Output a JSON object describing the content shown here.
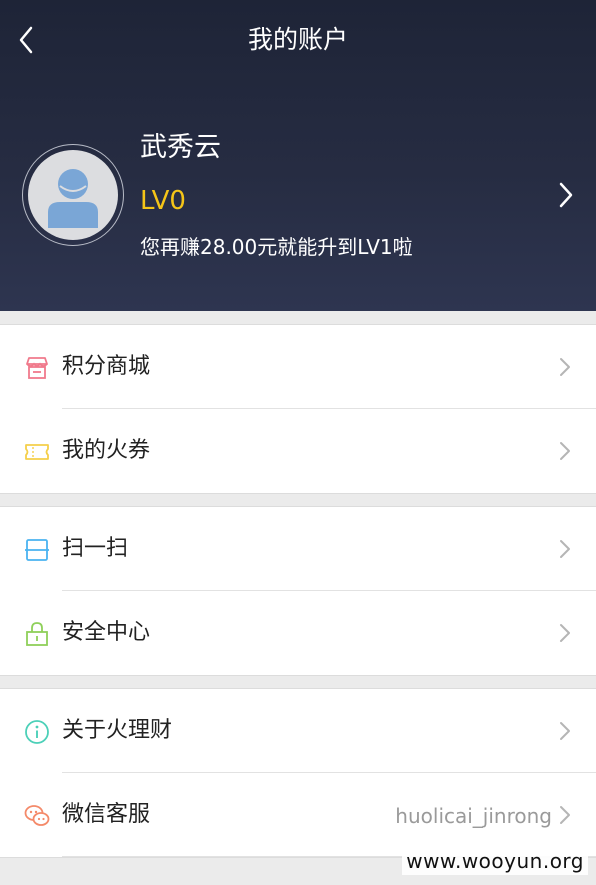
{
  "header": {
    "title": "我的账户",
    "back_icon": "back-chevron-icon"
  },
  "profile": {
    "name": "武秀云",
    "level": "LV0",
    "upgrade_text": "您再赚28.00元就能升到LV1啦",
    "arrow_icon": "chevron-right-icon",
    "avatar_icon": "default-avatar-icon"
  },
  "groups": [
    {
      "items": [
        {
          "label": "积分商城",
          "icon": "store-icon",
          "icon_color": "#f07a8c"
        },
        {
          "label": "我的火券",
          "icon": "ticket-icon",
          "icon_color": "#f5cf4a"
        }
      ]
    },
    {
      "items": [
        {
          "label": "扫一扫",
          "icon": "scan-icon",
          "icon_color": "#4ab3f0"
        },
        {
          "label": "安全中心",
          "icon": "lock-icon",
          "icon_color": "#8fd05a"
        }
      ]
    },
    {
      "items": [
        {
          "label": "关于火理财",
          "icon": "info-icon",
          "icon_color": "#4cd0b8"
        },
        {
          "label": "微信客服",
          "value": "huolicai_jinrong",
          "icon": "wechat-icon",
          "icon_color": "#f48a6a"
        }
      ]
    }
  ],
  "watermark": "www.wooyun.org",
  "colors": {
    "header_bg": "#262c42",
    "level": "#f5c518",
    "page_bg": "#ebebeb"
  }
}
